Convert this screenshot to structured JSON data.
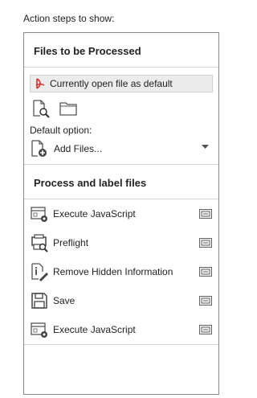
{
  "top_label": "Action steps to show:",
  "files_section": {
    "title": "Files to be Processed",
    "current_file": "Currently open file as default",
    "default_option_label": "Default option:",
    "add_files_label": "Add Files..."
  },
  "process_section": {
    "title": "Process and label files",
    "steps": [
      {
        "label": "Execute JavaScript",
        "icon": "execute-javascript-icon"
      },
      {
        "label": "Preflight",
        "icon": "preflight-icon"
      },
      {
        "label": "Remove Hidden Information",
        "icon": "remove-hidden-info-icon"
      },
      {
        "label": "Save",
        "icon": "save-icon"
      },
      {
        "label": "Execute JavaScript",
        "icon": "execute-javascript-icon"
      }
    ]
  },
  "colors": {
    "pdf_red": "#d4312b",
    "border": "#8a8a8a",
    "divider": "#d6d6d6"
  }
}
